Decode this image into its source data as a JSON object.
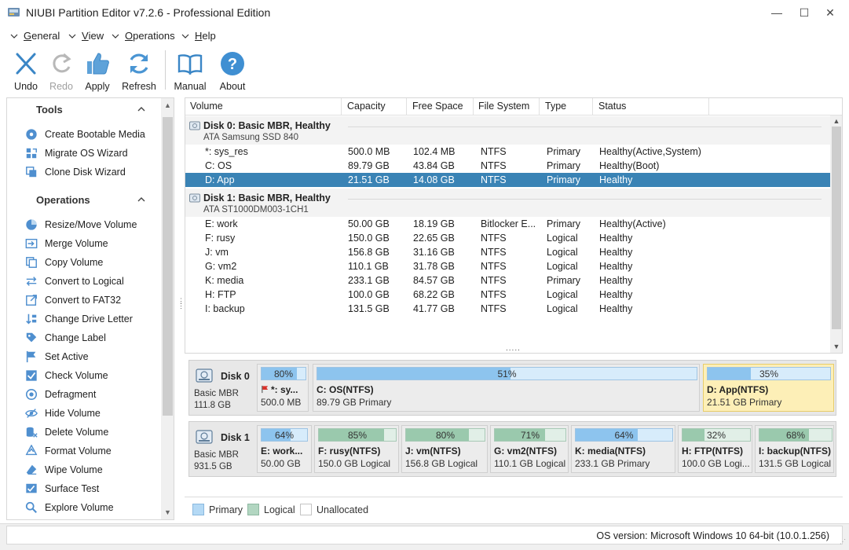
{
  "window": {
    "title": "NIUBI Partition Editor v7.2.6 - Professional Edition",
    "min_glyph": "—",
    "max_glyph": "☐",
    "close_glyph": "✕"
  },
  "menu": [
    {
      "label": "General",
      "key": "G",
      "rest": "eneral"
    },
    {
      "label": "View",
      "key": "V",
      "rest": "iew"
    },
    {
      "label": "Operations",
      "key": "O",
      "rest": "perations"
    },
    {
      "label": "Help",
      "key": "H",
      "rest": "elp"
    }
  ],
  "toolbar": {
    "undo": "Undo",
    "redo": "Redo",
    "apply": "Apply",
    "refresh": "Refresh",
    "manual": "Manual",
    "about": "About"
  },
  "left_panel": {
    "tools_title": "Tools",
    "tools": [
      "Create Bootable Media",
      "Migrate OS Wizard",
      "Clone Disk Wizard"
    ],
    "operations_title": "Operations",
    "operations": [
      "Resize/Move Volume",
      "Merge Volume",
      "Copy Volume",
      "Convert to Logical",
      "Convert to FAT32",
      "Change Drive Letter",
      "Change Label",
      "Set Active",
      "Check Volume",
      "Defragment",
      "Hide Volume",
      "Delete Volume",
      "Format Volume",
      "Wipe Volume",
      "Surface Test",
      "Explore Volume"
    ]
  },
  "volume_list": {
    "columns": [
      "Volume",
      "Capacity",
      "Free Space",
      "File System",
      "Type",
      "Status"
    ],
    "disks": [
      {
        "title": "Disk 0: Basic MBR, Healthy",
        "model": "ATA Samsung SSD 840",
        "volumes": [
          {
            "volume": "*: sys_res",
            "capacity": "500.0 MB",
            "free": "102.4 MB",
            "fs": "NTFS",
            "type": "Primary",
            "status": "Healthy(Active,System)",
            "selected": false
          },
          {
            "volume": "C: OS",
            "capacity": "89.79 GB",
            "free": "43.84 GB",
            "fs": "NTFS",
            "type": "Primary",
            "status": "Healthy(Boot)",
            "selected": false
          },
          {
            "volume": "D: App",
            "capacity": "21.51 GB",
            "free": "14.08 GB",
            "fs": "NTFS",
            "type": "Primary",
            "status": "Healthy",
            "selected": true
          }
        ]
      },
      {
        "title": "Disk 1: Basic MBR, Healthy",
        "model": "ATA ST1000DM003-1CH1",
        "volumes": [
          {
            "volume": "E: work",
            "capacity": "50.00 GB",
            "free": "18.19 GB",
            "fs": "Bitlocker E...",
            "type": "Primary",
            "status": "Healthy(Active)",
            "selected": false
          },
          {
            "volume": "F: rusy",
            "capacity": "150.0 GB",
            "free": "22.65 GB",
            "fs": "NTFS",
            "type": "Logical",
            "status": "Healthy",
            "selected": false
          },
          {
            "volume": "J: vm",
            "capacity": "156.8 GB",
            "free": "31.16 GB",
            "fs": "NTFS",
            "type": "Logical",
            "status": "Healthy",
            "selected": false
          },
          {
            "volume": "G: vm2",
            "capacity": "110.1 GB",
            "free": "31.78 GB",
            "fs": "NTFS",
            "type": "Logical",
            "status": "Healthy",
            "selected": false
          },
          {
            "volume": "K: media",
            "capacity": "233.1 GB",
            "free": "84.57 GB",
            "fs": "NTFS",
            "type": "Primary",
            "status": "Healthy",
            "selected": false
          },
          {
            "volume": "H: FTP",
            "capacity": "100.0 GB",
            "free": "68.22 GB",
            "fs": "NTFS",
            "type": "Logical",
            "status": "Healthy",
            "selected": false
          },
          {
            "volume": "I: backup",
            "capacity": "131.5 GB",
            "free": "41.77 GB",
            "fs": "NTFS",
            "type": "Logical",
            "status": "Healthy",
            "selected": false
          }
        ]
      }
    ],
    "splitter_dots": "....."
  },
  "disk_map": [
    {
      "name": "Disk 0",
      "type": "Basic MBR",
      "size": "111.8 GB",
      "partitions": [
        {
          "pct": "80%",
          "used": 80,
          "name": "*: sy...",
          "detail": "500.0 MB",
          "kind": "primary",
          "flag": true,
          "selected": false
        },
        {
          "pct": "51%",
          "used": 51,
          "name": "C: OS(NTFS)",
          "detail": "89.79 GB Primary",
          "kind": "primary",
          "flag": false,
          "selected": false
        },
        {
          "pct": "35%",
          "used": 35,
          "name": "D: App(NTFS)",
          "detail": "21.51 GB Primary",
          "kind": "primary",
          "flag": false,
          "selected": true
        }
      ]
    },
    {
      "name": "Disk 1",
      "type": "Basic MBR",
      "size": "931.5 GB",
      "partitions": [
        {
          "pct": "64%",
          "used": 64,
          "name": "E: work...",
          "detail": "50.00 GB",
          "kind": "primary",
          "flag": false,
          "selected": false
        },
        {
          "pct": "85%",
          "used": 85,
          "name": "F: rusy(NTFS)",
          "detail": "150.0 GB Logical",
          "kind": "logical",
          "flag": false,
          "selected": false
        },
        {
          "pct": "80%",
          "used": 80,
          "name": "J: vm(NTFS)",
          "detail": "156.8 GB Logical",
          "kind": "logical",
          "flag": false,
          "selected": false
        },
        {
          "pct": "71%",
          "used": 71,
          "name": "G: vm2(NTFS)",
          "detail": "110.1 GB Logical",
          "kind": "logical",
          "flag": false,
          "selected": false
        },
        {
          "pct": "64%",
          "used": 64,
          "name": "K: media(NTFS)",
          "detail": "233.1 GB Primary",
          "kind": "primary",
          "flag": false,
          "selected": false
        },
        {
          "pct": "32%",
          "used": 32,
          "name": "H: FTP(NTFS)",
          "detail": "100.0 GB Logi...",
          "kind": "logical",
          "flag": false,
          "selected": false
        },
        {
          "pct": "68%",
          "used": 68,
          "name": "I: backup(NTFS)",
          "detail": "131.5 GB Logical",
          "kind": "logical",
          "flag": false,
          "selected": false
        }
      ]
    }
  ],
  "legend": {
    "primary": "Primary",
    "logical": "Logical",
    "unallocated": "Unallocated"
  },
  "status_bar": {
    "os_version": "OS version: Microsoft Windows 10  64-bit  (10.0.1.256)"
  },
  "colors": {
    "selection": "#3a83b5",
    "primary_fill": "#8dc4ee",
    "logical_fill": "#9ac9ad",
    "selected_partition": "#fdefb7",
    "accent_blue": "#2b88d8"
  }
}
